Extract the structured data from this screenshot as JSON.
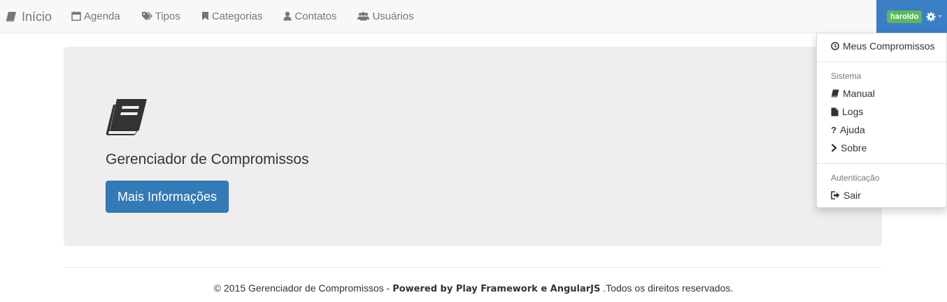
{
  "navbar": {
    "brand": {
      "label": "Início",
      "icon": "book-icon"
    },
    "items": [
      {
        "label": "Agenda",
        "icon": "calendar-icon"
      },
      {
        "label": "Tipos",
        "icon": "tags-icon"
      },
      {
        "label": "Categorias",
        "icon": "bookmark-icon"
      },
      {
        "label": "Contatos",
        "icon": "user-icon"
      },
      {
        "label": "Usuários",
        "icon": "users-icon"
      }
    ],
    "user": {
      "name": "haroldo",
      "icon": "gear-icon",
      "color": "#3a7fc5",
      "badge_color": "#5cb85c"
    }
  },
  "jumbotron": {
    "icon": "book-icon",
    "title": "Gerenciador de Compromissos",
    "button": "Mais Informações",
    "button_color": "#337ab7"
  },
  "dropdown": {
    "item_top": {
      "label": "Meus Compromissos",
      "icon": "clock-icon"
    },
    "header_sistema": "Sistema",
    "sistema": [
      {
        "label": "Manual",
        "icon": "book-icon"
      },
      {
        "label": "Logs",
        "icon": "file-icon"
      },
      {
        "label": "Ajuda",
        "icon": "question-icon"
      },
      {
        "label": "Sobre",
        "icon": "chevron-right-icon"
      }
    ],
    "header_autenticacao": "Autenticação",
    "sair": {
      "label": "Sair",
      "icon": "sign-out-icon"
    }
  },
  "footer": {
    "prefix": "© 2015 Gerenciador de Compromissos - ",
    "powered": "Powered by Play Framework e AngularJS",
    "suffix": " .Todos os direitos reservados."
  }
}
